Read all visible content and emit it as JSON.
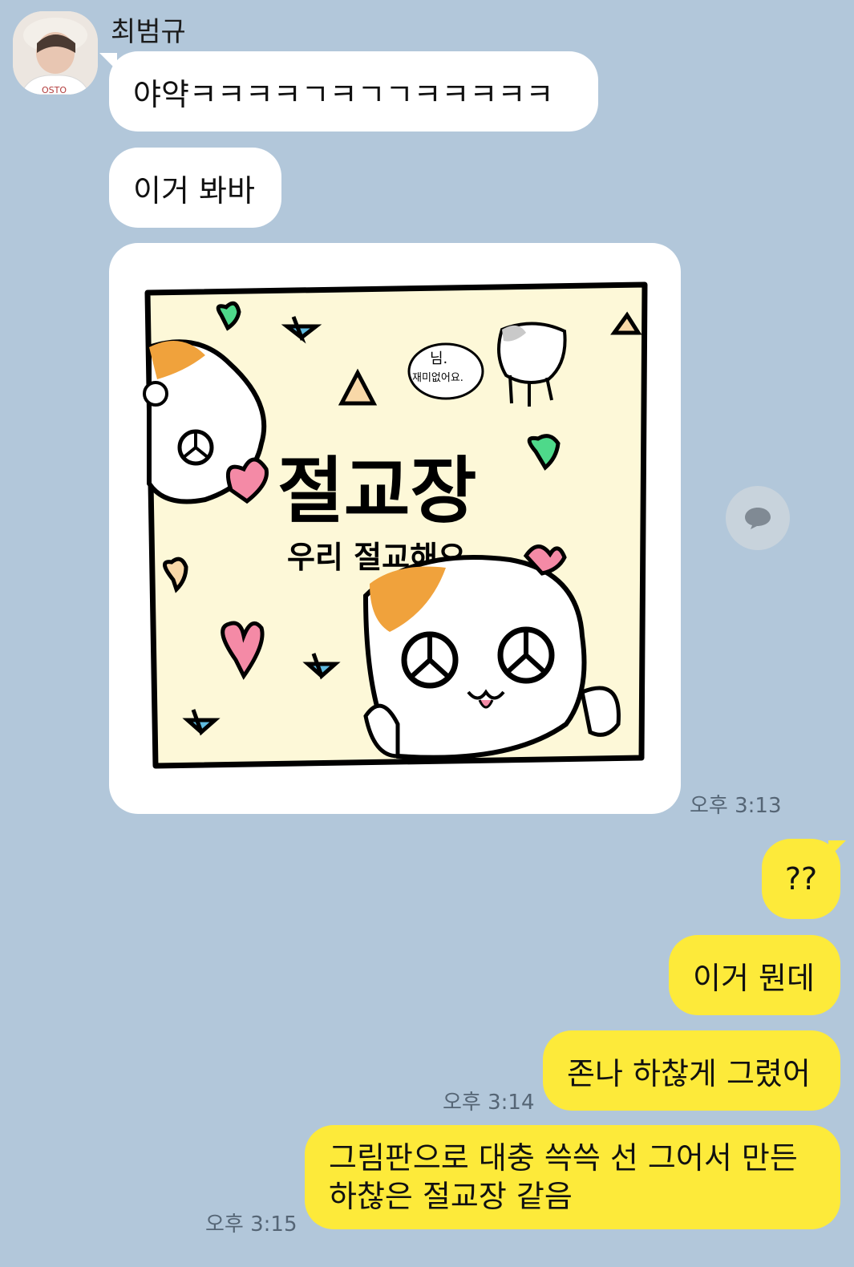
{
  "sender": {
    "name": "최범규"
  },
  "messages_in": [
    {
      "text": "야약ㅋㅋㅋㅋㄱㅋㄱㄱㅋㅋㅋㅋㅋ"
    },
    {
      "text": "이거 봐바"
    }
  ],
  "image_message": {
    "title": "절교장",
    "subtitle": "우리 절교해요",
    "speech": "님.\n재미없어요.",
    "time": "오후 3:13"
  },
  "messages_out": [
    {
      "text": "??"
    },
    {
      "text": "이거 뭔데"
    },
    {
      "text": "존나 하찮게 그렸어",
      "time": "오후 3:14"
    },
    {
      "line1": "그림판으로 대충 쓱쓱 선 그어서 만든",
      "line2": "하찮은 절교장 같음",
      "time": "오후 3:15"
    }
  ],
  "icons": {
    "share": "speech-bubble-icon",
    "avatar": "profile-photo"
  },
  "colors": {
    "background": "#b2c7da",
    "outgoing": "#fdea3a",
    "incoming": "#ffffff"
  }
}
